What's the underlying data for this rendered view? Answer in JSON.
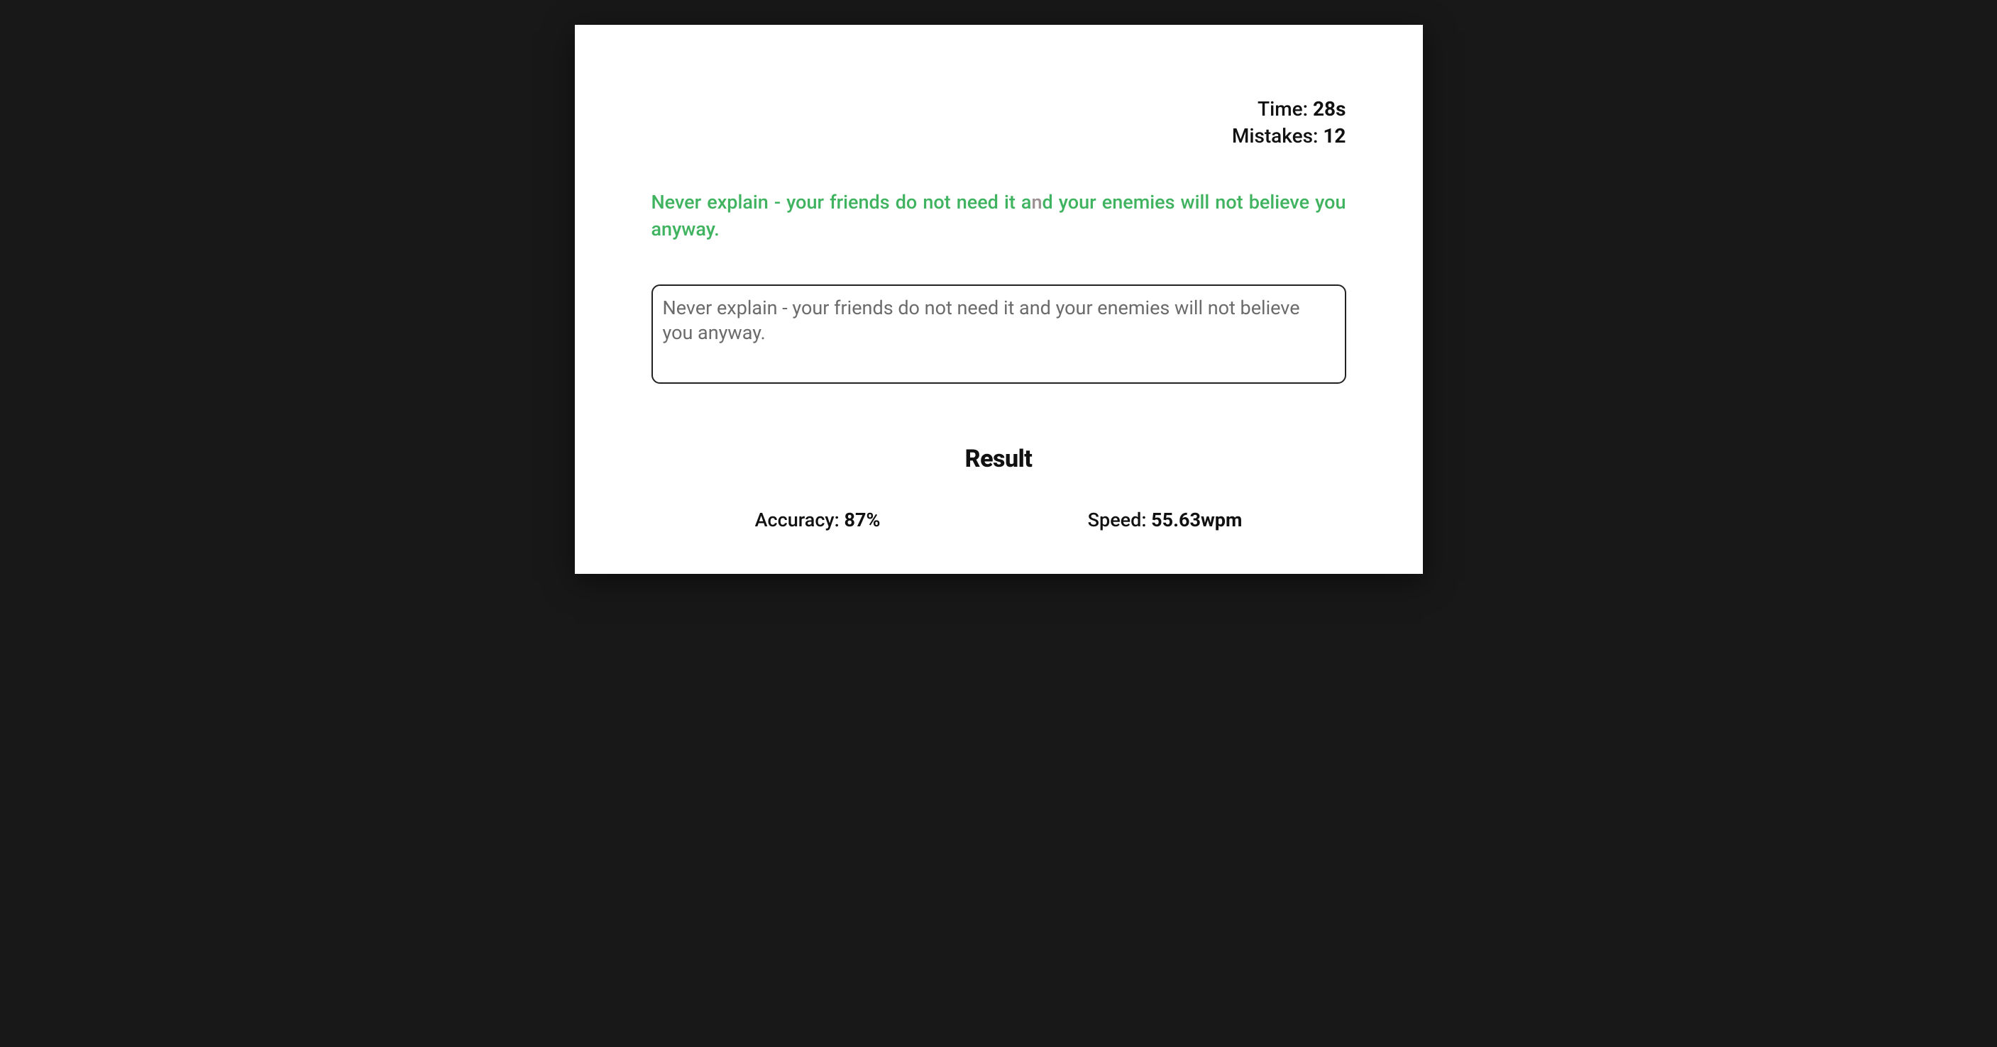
{
  "stats": {
    "time_label": "Time: ",
    "time_value": "28s",
    "mistakes_label": "Mistakes: ",
    "mistakes_value": "12"
  },
  "prompt": {
    "seg1": "Never  explain  -  your  friends  do  not  need  it  a",
    "mistake_char": "n",
    "seg2": "d  your  enemies  will  not  believe  you anyway."
  },
  "input": {
    "value": "Never explain - your friends do not need it and your enemies will not believe you anyway."
  },
  "result": {
    "heading": "Result",
    "accuracy_label": "Accuracy: ",
    "accuracy_value": "87%",
    "speed_label": "Speed: ",
    "speed_value": "55.63wpm"
  }
}
